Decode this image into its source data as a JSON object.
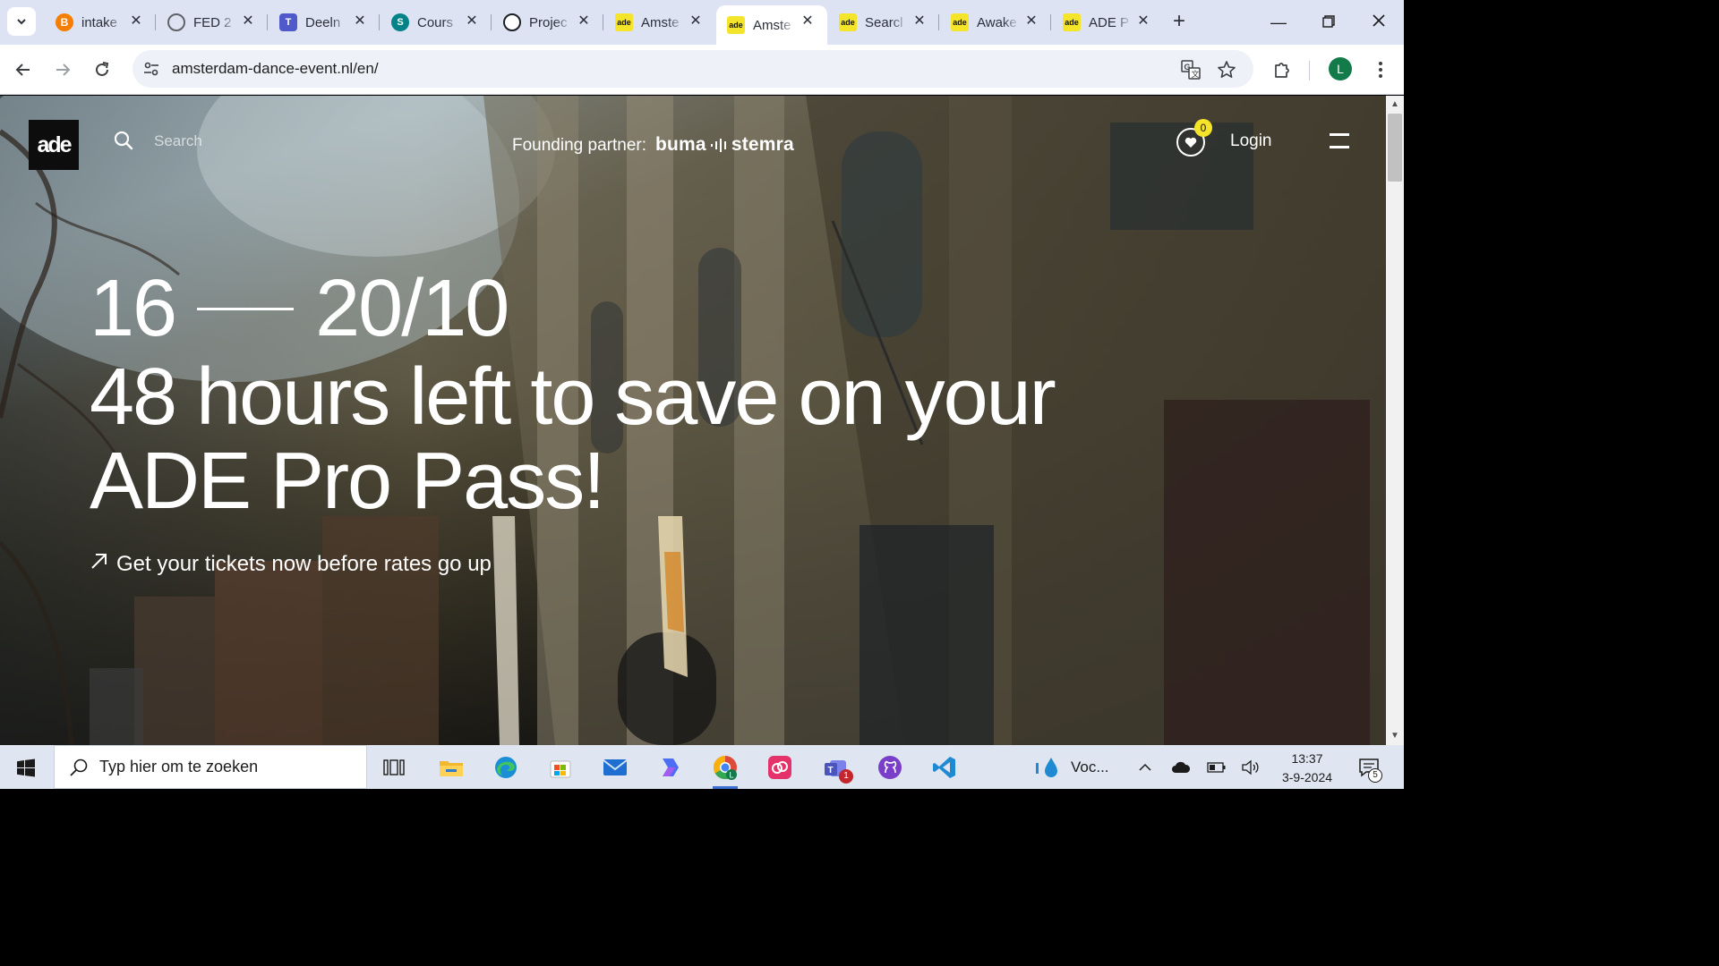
{
  "browser": {
    "tabs": [
      {
        "label": "intake",
        "icon": "blogger-icon",
        "color": "#f57d00"
      },
      {
        "label": "FED 2",
        "icon": "globe-icon",
        "color": "#5f6368"
      },
      {
        "label": "Deeln",
        "icon": "teams-icon",
        "color": "#5059c9"
      },
      {
        "label": "Cours",
        "icon": "sharepoint-icon",
        "color": "#038387"
      },
      {
        "label": "Projec",
        "icon": "github-icon",
        "color": "#1b1f23"
      },
      {
        "label": "Amste",
        "icon": "ade-icon",
        "color": "#f5e52a"
      },
      {
        "label": "Amste",
        "icon": "ade-icon",
        "color": "#f5e52a"
      },
      {
        "label": "Searcl",
        "icon": "ade-icon",
        "color": "#f5e52a"
      },
      {
        "label": "Awake",
        "icon": "ade-icon",
        "color": "#f5e52a"
      },
      {
        "label": "ADE P",
        "icon": "ade-icon",
        "color": "#f5e52a"
      }
    ],
    "tab_favicon_text": "ade",
    "active_tab_index": 6,
    "url": "amsterdam-dance-event.nl/en/",
    "profile_initial": "L",
    "profile_color": "#137a4a"
  },
  "site": {
    "logo_text": "ade",
    "search_placeholder": "Search",
    "founding_label": "Founding partner:",
    "founding_partner_left": "buma",
    "founding_partner_right": "stemra",
    "favorites_count": "0",
    "login_label": "Login",
    "hero": {
      "date_start": "16",
      "date_end": "20/10",
      "title": "48 hours left to save on your ADE Pro Pass!",
      "cta": "Get your tickets now before rates go up"
    },
    "accent_color": "#f5e52a"
  },
  "taskbar": {
    "search_placeholder": "Typ hier om te zoeken",
    "apps": [
      "task-view-icon",
      "file-explorer-icon",
      "edge-icon",
      "store-icon",
      "mail-icon",
      "copilot-icon",
      "chrome-icon",
      "creative-cloud-icon",
      "teams-icon",
      "github-desktop-icon",
      "vscode-icon"
    ],
    "teams_badge": "1",
    "weather_label": "Voc...",
    "time": "13:37",
    "date": "3-9-2024",
    "notification_count": "5"
  }
}
